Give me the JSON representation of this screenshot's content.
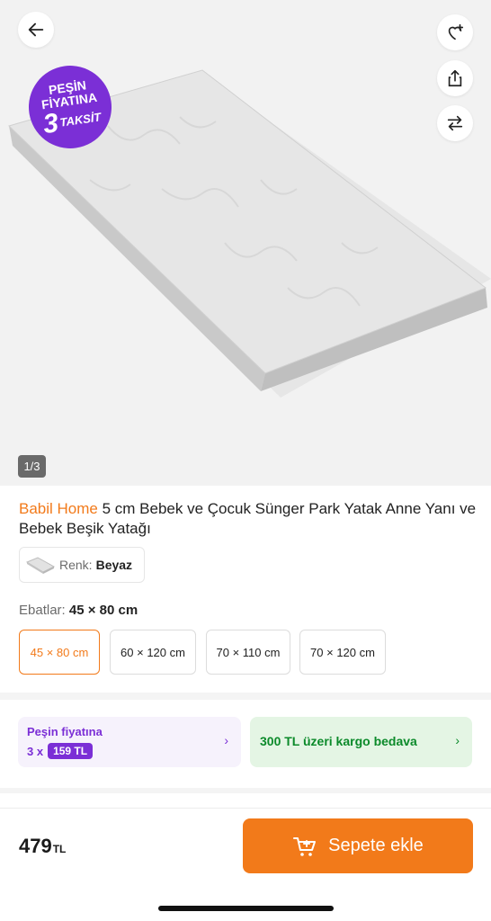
{
  "gallery": {
    "counter": "1/3",
    "promo_badge": {
      "line1": "PEŞİN",
      "line2": "FİYATINA",
      "number": "3",
      "word": "TAKSİT"
    }
  },
  "icons": {
    "back": "arrow-left-icon",
    "favorite": "heart-collection-icon",
    "share": "share-icon",
    "compare": "compare-arrows-icon"
  },
  "product": {
    "brand": "Babil Home",
    "name": "5 cm Bebek ve Çocuk Sünger Park Yatak Anne Yanı ve Bebek Beşik Yatağı",
    "color_label": "Renk:",
    "color_value": "Beyaz",
    "size_label": "Ebatlar:",
    "size_value": "45 × 80 cm",
    "sizes": [
      "45 × 80 cm",
      "60 × 120 cm",
      "70 × 110 cm",
      "70 × 120 cm"
    ],
    "selected_size_index": 0
  },
  "payment": {
    "label": "Peşin fiyatına",
    "installment_prefix": "3 x",
    "installment_amount": "159 TL"
  },
  "shipping": {
    "label": "300 TL üzeri kargo bedava"
  },
  "footer": {
    "price": "479",
    "currency": "TL",
    "cart_button": "Sepete ekle"
  },
  "colors": {
    "brand_orange": "#f27a1a",
    "promo_purple": "#7b2fd6",
    "shipping_green": "#0b8a2a"
  }
}
